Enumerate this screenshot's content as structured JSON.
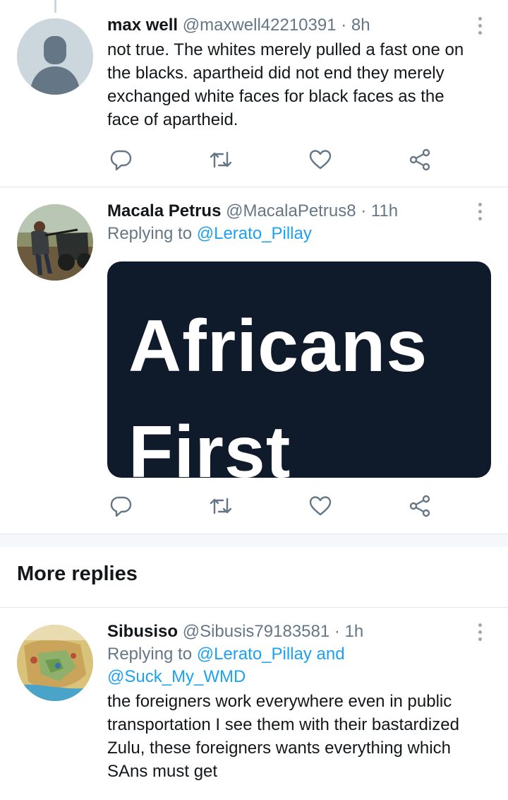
{
  "tweets": [
    {
      "name": "max well",
      "handle": "@maxwell42210391",
      "separator": "·",
      "time": "8h",
      "text": "not true. The whites merely pulled a fast one on the blacks. apartheid did not end they merely exchanged white faces for black faces as the face of apartheid."
    },
    {
      "name": "Macala Petrus",
      "handle": "@MacalaPetrus8",
      "separator": "·",
      "time": "11h",
      "replying_prefix": "Replying to",
      "replying_to": "@Lerato_Pillay",
      "media_text_line1": "Africans",
      "media_text_line2": "First"
    },
    {
      "name": "Sibusiso",
      "handle": "@Sibusis79183581",
      "separator": "·",
      "time": "1h",
      "replying_prefix": "Replying to",
      "replying_to": "@Lerato_Pillay and @Suck_My_WMD",
      "text": "the foreigners work everywhere even in public transportation I see them with their bastardized Zulu, these foreigners wants everything which SAns must get"
    }
  ],
  "section": {
    "more_replies": "More replies"
  },
  "icons": {
    "reply": "reply-icon",
    "retweet": "retweet-icon",
    "like": "heart-icon",
    "share": "share-icon",
    "more": "more-vertical-icon"
  },
  "colors": {
    "accent": "#1da1f2",
    "secondary_text": "#657786",
    "icon": "#657786"
  }
}
